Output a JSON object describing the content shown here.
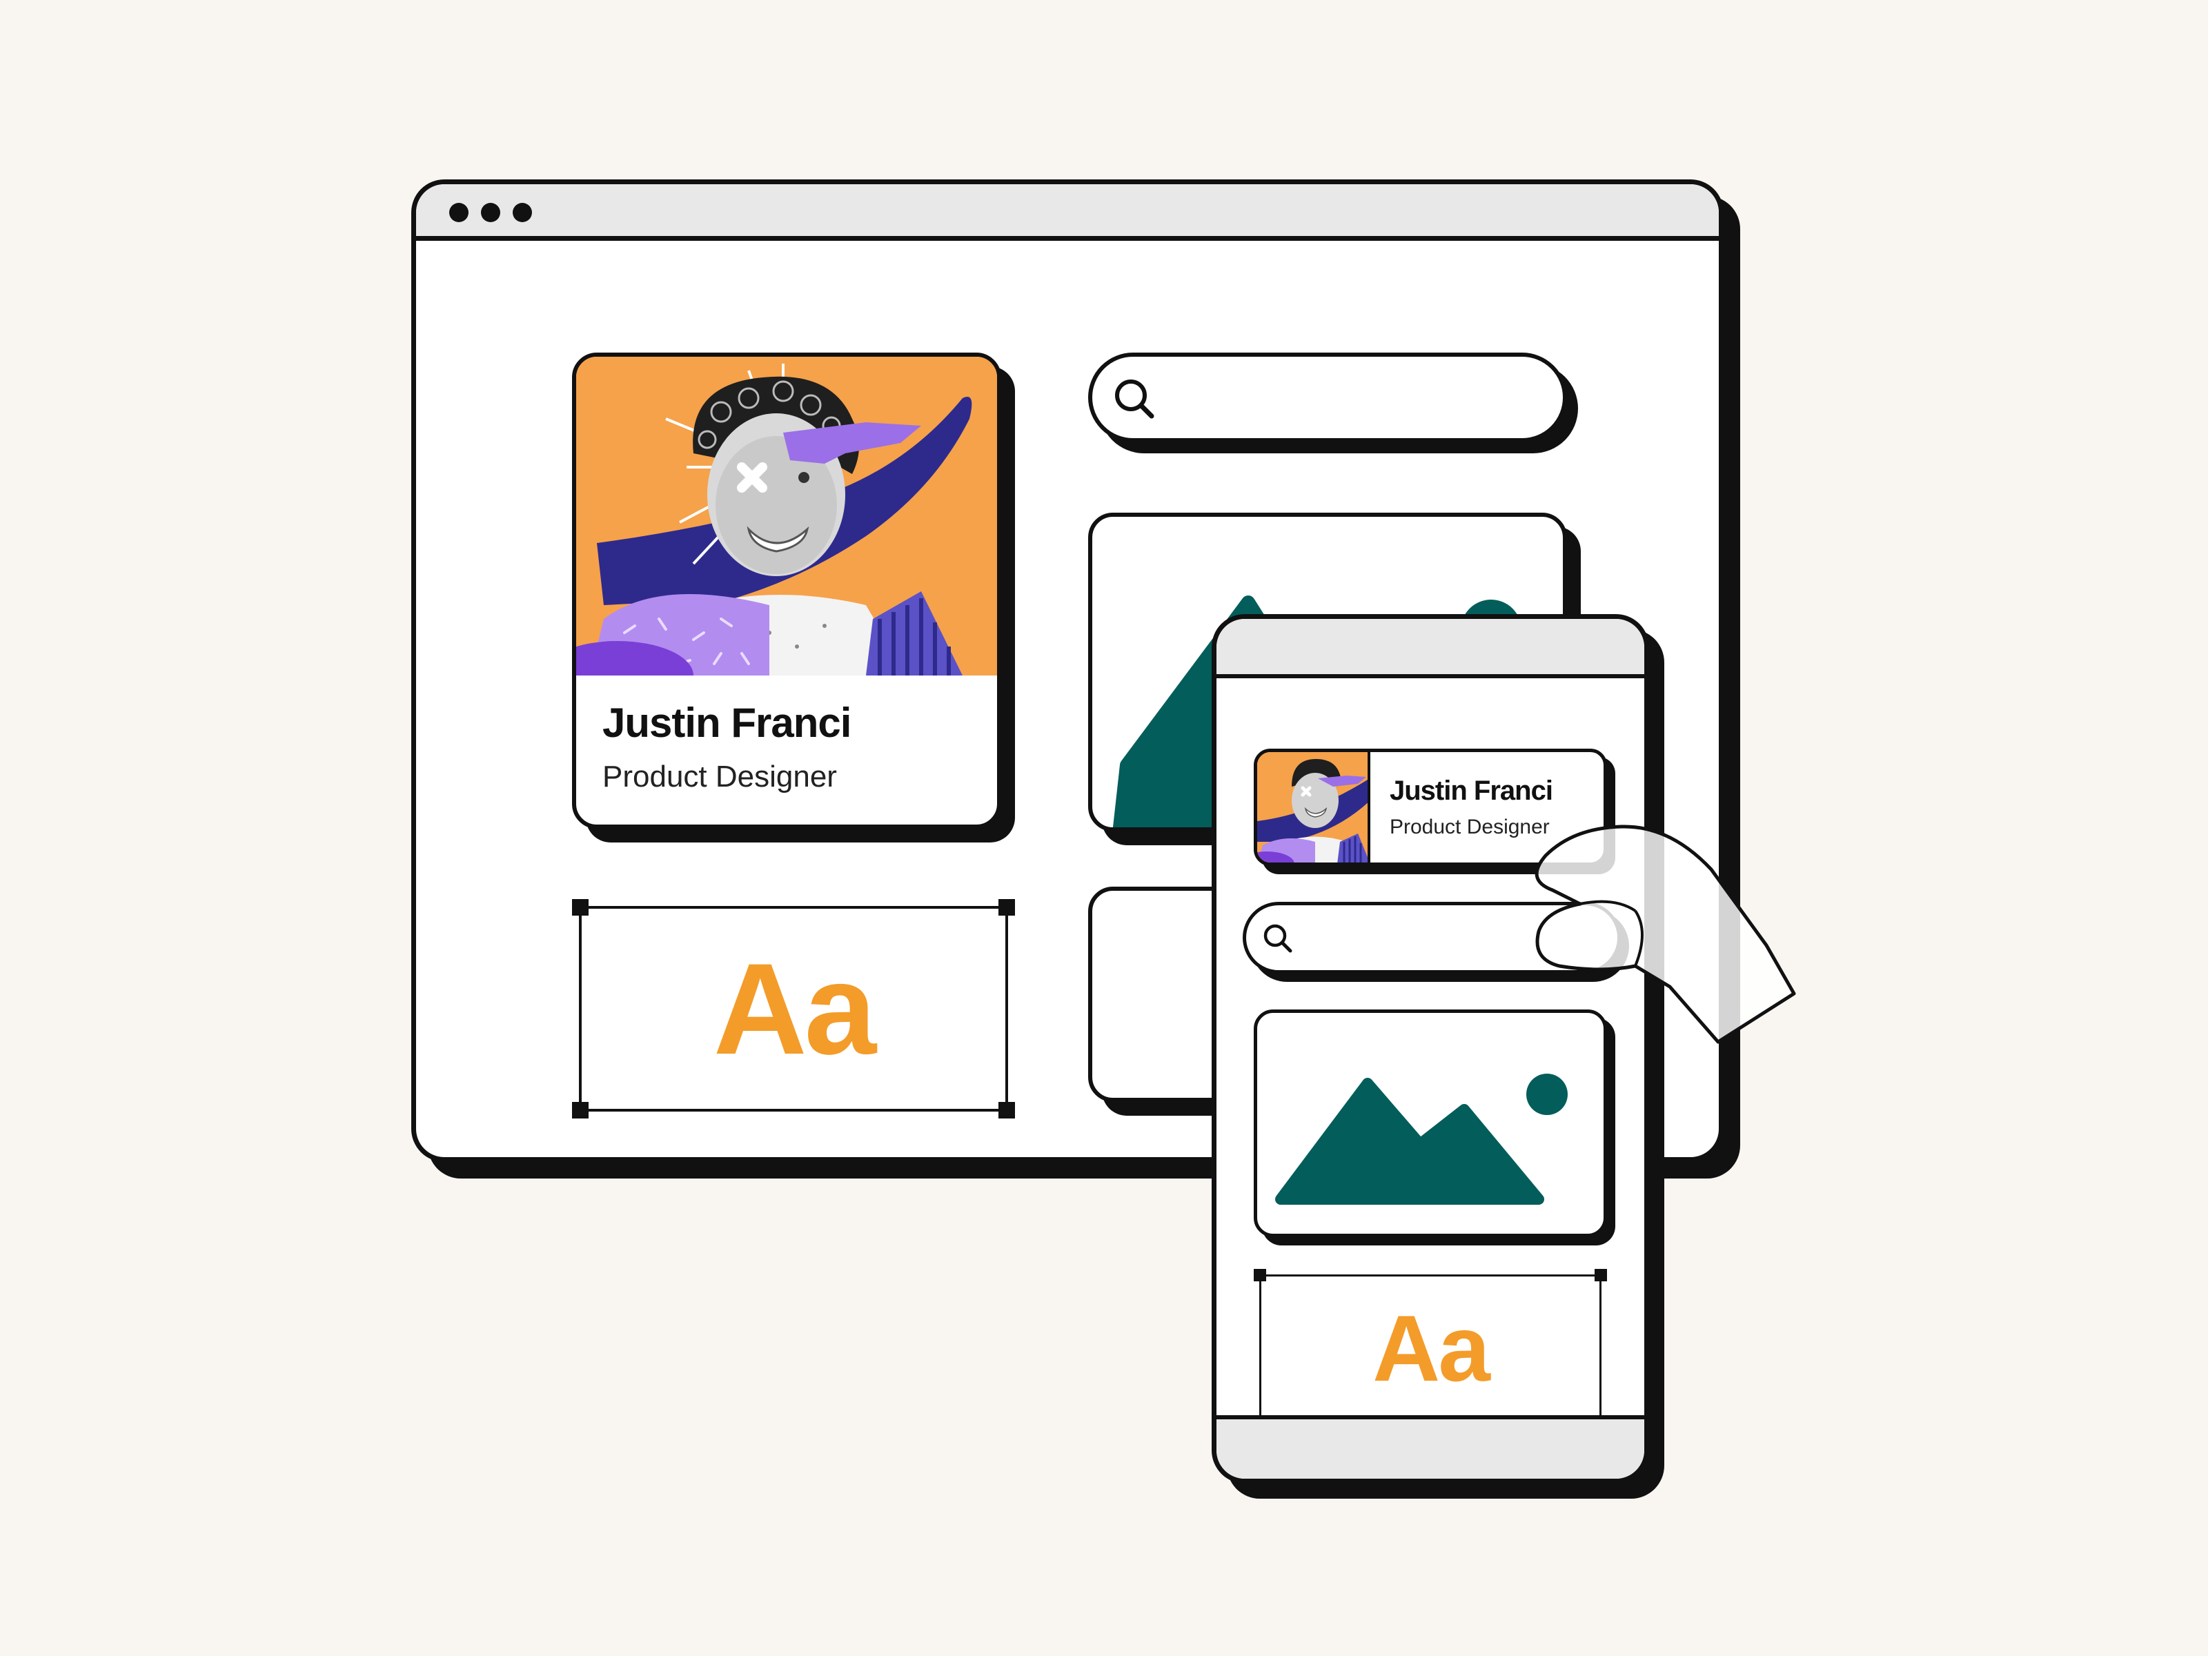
{
  "desktop": {
    "window_dots": 3,
    "profile": {
      "name": "Justin Franci",
      "role": "Product Designer"
    },
    "search": {
      "placeholder": ""
    },
    "text_sample": "Aa"
  },
  "mobile": {
    "profile": {
      "name": "Justin Franci",
      "role": "Product Designer"
    },
    "search": {
      "placeholder": ""
    },
    "text_sample": "Aa"
  },
  "colors": {
    "background": "#f9f6f2",
    "accent_orange": "#f39c2a",
    "photo_orange": "#f5a24b",
    "teal": "#035d5b",
    "purple": "#9b6fe8",
    "navy": "#2e2a8c",
    "chrome_gray": "#e8e8e8",
    "outline": "#111111"
  },
  "icons": [
    "search-icon",
    "image-placeholder-icon",
    "hand-pointer-icon",
    "close-mark-icon"
  ]
}
